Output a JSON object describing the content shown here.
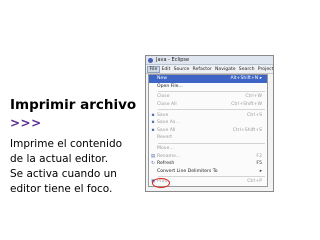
{
  "slide": {
    "title": "Imprimir archivo",
    "arrows": ">>>",
    "description_lines": [
      "Imprime el contenido",
      "de la actual editor.",
      "Se activa cuando un",
      "editor tiene el foco."
    ],
    "colors": {
      "arrows": "#5b2c91",
      "highlight_circle": "#e0201c",
      "menu_selection": "#3e65c5"
    }
  },
  "window": {
    "title": "Java - Eclipse",
    "menubar": [
      "File",
      "Edit",
      "Source",
      "Refactor",
      "Navigate",
      "Search",
      "Project"
    ],
    "menu": {
      "items": [
        {
          "icon": "",
          "label": "New",
          "shortcut": "Alt+Shift+N ▸",
          "selected": true
        },
        {
          "icon": "",
          "label": "Open File...",
          "shortcut": ""
        },
        {
          "sep": true
        },
        {
          "icon": "",
          "label": "Close",
          "shortcut": "Ctrl+W",
          "disabled": true
        },
        {
          "icon": "",
          "label": "Close All",
          "shortcut": "Ctrl+Shift+W",
          "disabled": true
        },
        {
          "sep": true
        },
        {
          "icon": "save-icon",
          "label": "Save",
          "shortcut": "Ctrl+S",
          "disabled": true
        },
        {
          "icon": "save-as-icon",
          "label": "Save As...",
          "shortcut": "",
          "disabled": true
        },
        {
          "icon": "save-all-icon",
          "label": "Save All",
          "shortcut": "Ctrl+Shift+S",
          "disabled": true
        },
        {
          "icon": "",
          "label": "Revert",
          "shortcut": "",
          "disabled": true
        },
        {
          "sep": true
        },
        {
          "icon": "",
          "label": "Move...",
          "shortcut": "",
          "disabled": true
        },
        {
          "icon": "rename-icon",
          "label": "Rename...",
          "shortcut": "F2",
          "disabled": true
        },
        {
          "icon": "refresh-icon",
          "label": "Refresh",
          "shortcut": "F5"
        },
        {
          "icon": "",
          "label": "Convert Line Delimiters To",
          "shortcut": "▸"
        },
        {
          "sep": true
        },
        {
          "icon": "print-icon",
          "label": "Print...",
          "shortcut": "Ctrl+P",
          "disabled": true,
          "circled": true
        }
      ]
    }
  }
}
